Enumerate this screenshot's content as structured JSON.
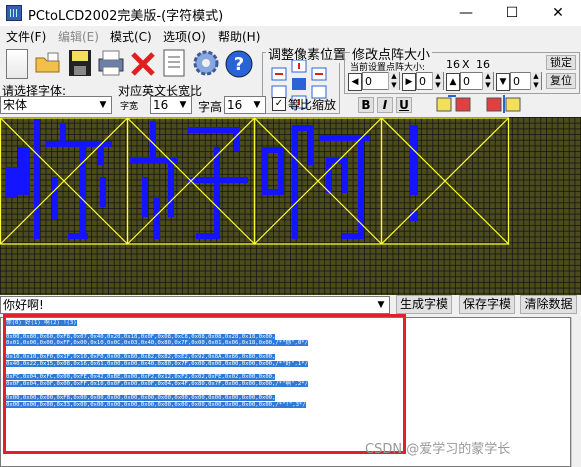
{
  "window": {
    "title": "PCtoLCD2002完美版-(字符模式)",
    "minimize": "—",
    "maximize": "☐",
    "close": "✕"
  },
  "menu": [
    "文件(F)",
    "编辑(E)",
    "模式(C)",
    "选项(O)",
    "帮助(H)"
  ],
  "toolbar": {
    "icons": [
      "new-icon",
      "open-icon",
      "save-icon",
      "print-icon",
      "delete-icon",
      "notes-icon",
      "settings-gear-icon",
      "help-icon"
    ]
  },
  "pixel_adjust": {
    "title": "调整像素位置"
  },
  "size_panel": {
    "title": "修改点阵大小",
    "current_label": "当前设置点阵大小:",
    "current_w": "16",
    "x_sep": "X",
    "current_h": "16",
    "spins": [
      "0",
      "0",
      "0",
      "0"
    ],
    "lock_btn": "锁定",
    "restore_btn": "复位"
  },
  "font_area": {
    "choose_label": "请选择字体:",
    "font_value": "宋体",
    "width_label": "对应英文长宽比",
    "width_prefix": "字宽",
    "width_value": "16",
    "height_label": "字高",
    "height_value": "16",
    "proportional_label": "等比缩放",
    "proportional_checked": true,
    "bold": "B",
    "italic": "I",
    "underline": "U"
  },
  "canvas": {
    "chars": [
      "你",
      "好",
      "啊",
      "!"
    ]
  },
  "input": {
    "text": "你好啊!"
  },
  "buttons": {
    "generate": "生成字模",
    "save": "保存字模",
    "clear": "清除数据"
  },
  "output": {
    "lines": [
      {
        "text": "你(0) 好(1) 啊(2) !(3)",
        "hl": true
      },
      {
        "text": "",
        "hl": false
      },
      {
        "text": "0x00,0x80,0x60,0xF8,0x07,0x40,0x20,0x18,0x0F,0x08,0xC8,0x08,0x08,0x28,0x18,0x00,",
        "hl": true
      },
      {
        "text": "0x01,0x00,0x00,0xFF,0x00,0x10,0x0C,0x03,0x40,0x80,0x7F,0x00,0x01,0x06,0x18,0x00,/*\"你\",0*/",
        "hl": true
      },
      {
        "text": "",
        "hl": false
      },
      {
        "text": "0x10,0x10,0xF0,0x1F,0x10,0xF0,0x00,0x80,0x82,0x82,0xE2,0x92,0x8A,0x86,0x80,0x00,",
        "hl": true
      },
      {
        "text": "0x40,0x22,0x15,0x08,0x16,0x61,0x00,0x00,0x40,0x80,0x7F,0x00,0x00,0x00,0x00,0x00,/*\"好\",1*/",
        "hl": true
      },
      {
        "text": "",
        "hl": false
      },
      {
        "text": "0xFC,0x04,0xFC,0x00,0xFE,0x42,0xBE,0x00,0xF2,0x12,0xF2,0x02,0xFE,0x02,0x00,0x00,",
        "hl": true
      },
      {
        "text": "0x0F,0x04,0x0F,0x00,0xFF,0x10,0x0F,0x00,0x0F,0x04,0x4F,0x80,0x7F,0x00,0x00,0x00,/*\"啊\",2*/",
        "hl": true
      },
      {
        "text": "",
        "hl": false
      },
      {
        "text": "0x00,0x00,0x00,0xF8,0x00,0x00,0x00,0x00,0x00,0x00,0x00,0x00,0x00,0x00,0x00,0x00,",
        "hl": true
      },
      {
        "text": "0x00,0x00,0x00,0x33,0x00,0x00,0x00,0x00,0x00,0x00,0x00,0x00,0x00,0x00,0x00,0x00,/*\"!\",3*/",
        "hl": true
      }
    ]
  },
  "watermark": "CSDN @爱学习的蒙学长",
  "colors": {
    "canvas_bg": "#4b4b1c",
    "pixel_on": "#1414ff",
    "grid_frame": "#ffff33",
    "selection": "#2f7ad8",
    "red_box": "#e0202a"
  }
}
